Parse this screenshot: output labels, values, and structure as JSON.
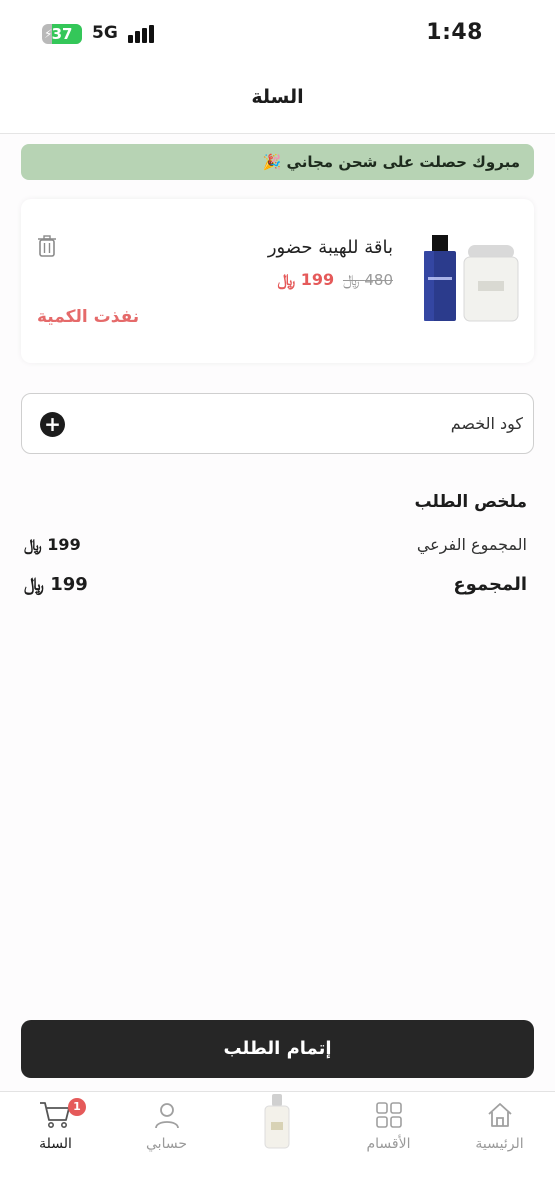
{
  "status_bar": {
    "time": "1:48",
    "battery": "37",
    "network": "5G"
  },
  "header": {
    "title": "السلة"
  },
  "banner": {
    "text": "مبروك حصلت على شحن مجاني 🎉"
  },
  "cart": {
    "items": [
      {
        "name": "باقة للهيبة حضور",
        "old_price": "480",
        "new_price": "199",
        "currency": "﷼",
        "stock_status": "نفذت الكمية"
      }
    ]
  },
  "coupon": {
    "label": "كود الخصم",
    "add_symbol": "+"
  },
  "summary": {
    "title": "ملخص الطلب",
    "subtotal_label": "المجموع الفرعي",
    "subtotal_value": "199 ﷼",
    "total_label": "المجموع",
    "total_value": "199 ﷼"
  },
  "checkout": {
    "label": "إتمام الطلب"
  },
  "tabbar": {
    "home": "الرئيسية",
    "categories": "الأقسام",
    "account": "حسابي",
    "cart": "السلة",
    "cart_badge": "1"
  },
  "colors": {
    "accent": "#e55a5a",
    "banner": "#b7d3b4",
    "primary": "#262626"
  }
}
